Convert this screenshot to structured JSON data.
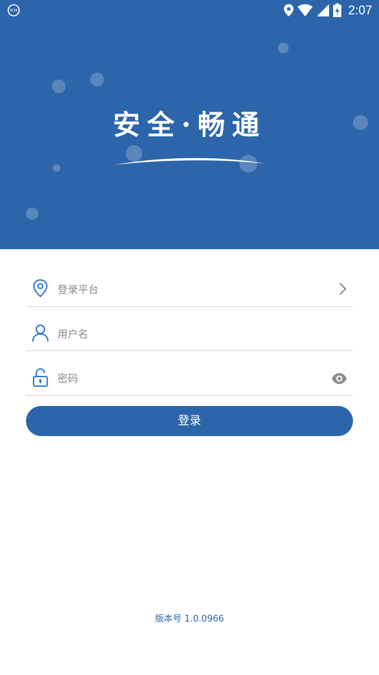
{
  "status_bar": {
    "time": "2:07",
    "icons": [
      "vpn-icon",
      "location-icon",
      "wifi-icon",
      "signal-icon",
      "battery-icon"
    ]
  },
  "hero": {
    "slogan": "安全·畅通",
    "background_color": "#2c65a9"
  },
  "form": {
    "platform": {
      "placeholder": "登录平台",
      "icon": "location-pin-icon",
      "trail_icon": "chevron-right-icon"
    },
    "username": {
      "placeholder": "用户名",
      "icon": "user-icon"
    },
    "password": {
      "placeholder": "密码",
      "icon": "lock-icon",
      "trail_icon": "eye-icon"
    }
  },
  "login_button": {
    "label": "登录"
  },
  "footer": {
    "version": "版本号 1.0.0966"
  },
  "colors": {
    "accent": "#2c65a9",
    "divider": "#d6d6d6",
    "placeholder": "#8a8a8a"
  }
}
